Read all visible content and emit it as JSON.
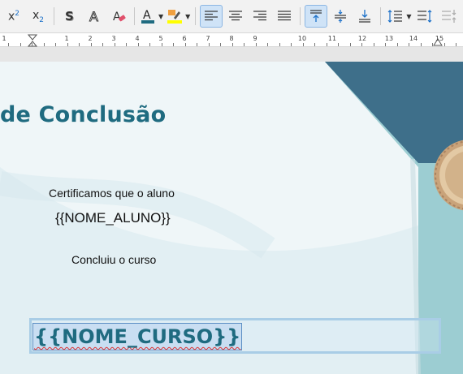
{
  "toolbar": {
    "buttons": [
      {
        "name": "superscript-button",
        "icon": "superscript-icon",
        "label": "x²"
      },
      {
        "name": "subscript-button",
        "icon": "subscript-icon",
        "label": "x₂"
      },
      {
        "name": "shadow-button",
        "icon": "shadow-icon",
        "label": "S"
      },
      {
        "name": "outline-button",
        "icon": "outline-icon",
        "label": "A"
      },
      {
        "name": "clear-formatting-button",
        "icon": "clear-formatting-icon"
      },
      {
        "name": "font-color-button",
        "icon": "font-color-icon",
        "label": "A",
        "color": "#1f6b80"
      },
      {
        "name": "highlight-button",
        "icon": "highlighter-icon",
        "color": "#ffff00"
      },
      {
        "name": "align-left-button",
        "icon": "align-left-icon",
        "active": true
      },
      {
        "name": "align-center-button",
        "icon": "align-center-icon"
      },
      {
        "name": "align-right-button",
        "icon": "align-right-icon"
      },
      {
        "name": "justify-button",
        "icon": "justify-icon"
      },
      {
        "name": "align-top-button",
        "icon": "align-top-icon",
        "active": true
      },
      {
        "name": "align-middle-button",
        "icon": "align-middle-icon"
      },
      {
        "name": "align-bottom-button",
        "icon": "align-bottom-icon"
      },
      {
        "name": "line-spacing-button",
        "icon": "line-spacing-icon"
      },
      {
        "name": "increase-paragraph-spacing-button",
        "icon": "increase-spacing-icon"
      },
      {
        "name": "decrease-paragraph-spacing-button",
        "icon": "decrease-spacing-icon"
      }
    ]
  },
  "ruler": {
    "numbers": [
      "1",
      "1",
      "2",
      "3",
      "4",
      "5",
      "6",
      "7",
      "8",
      "9",
      "10",
      "11",
      "12",
      "13",
      "14",
      "15"
    ]
  },
  "document": {
    "title": "de Conclusão",
    "certify_text": "Certificamos que o aluno",
    "student_placeholder": "{{NOME_ALUNO}}",
    "completed_text": "Concluiu o curso",
    "course_placeholder": "{{NOME_CURSO}}"
  },
  "colors": {
    "title": "#1f6b80",
    "corner_dark": "#3e6f8a",
    "corner_light": "#9ccdd2",
    "selection": "#c9def2",
    "page_background": "#eff6f8"
  }
}
